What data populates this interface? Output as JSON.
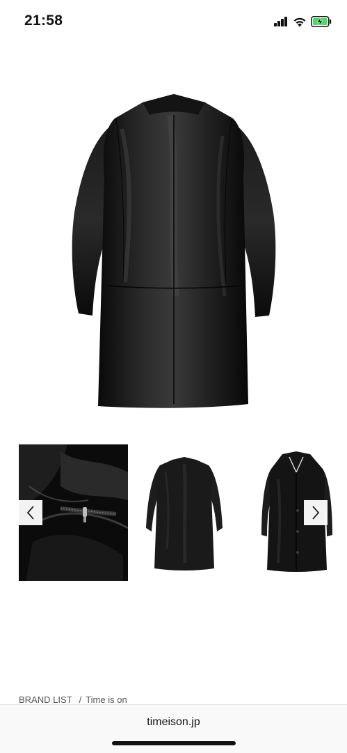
{
  "status_bar": {
    "time": "21:58",
    "icons": [
      "signal-icon",
      "wifi-icon",
      "battery-charging-icon"
    ],
    "battery_color": "#4cd964"
  },
  "product": {
    "main_image": "leather-coat-back-view",
    "thumbnails": [
      {
        "image": "leather-coat-lining-zipper-detail"
      },
      {
        "image": "leather-coat-back-view"
      },
      {
        "image": "leather-coat-front-view"
      }
    ],
    "prev_icon": "chevron-left-icon",
    "next_icon": "chevron-right-icon"
  },
  "breadcrumb": {
    "items": [
      "BRAND LIST",
      "Time is on"
    ],
    "separator": "/"
  },
  "browser": {
    "url": "timeison.jp"
  }
}
